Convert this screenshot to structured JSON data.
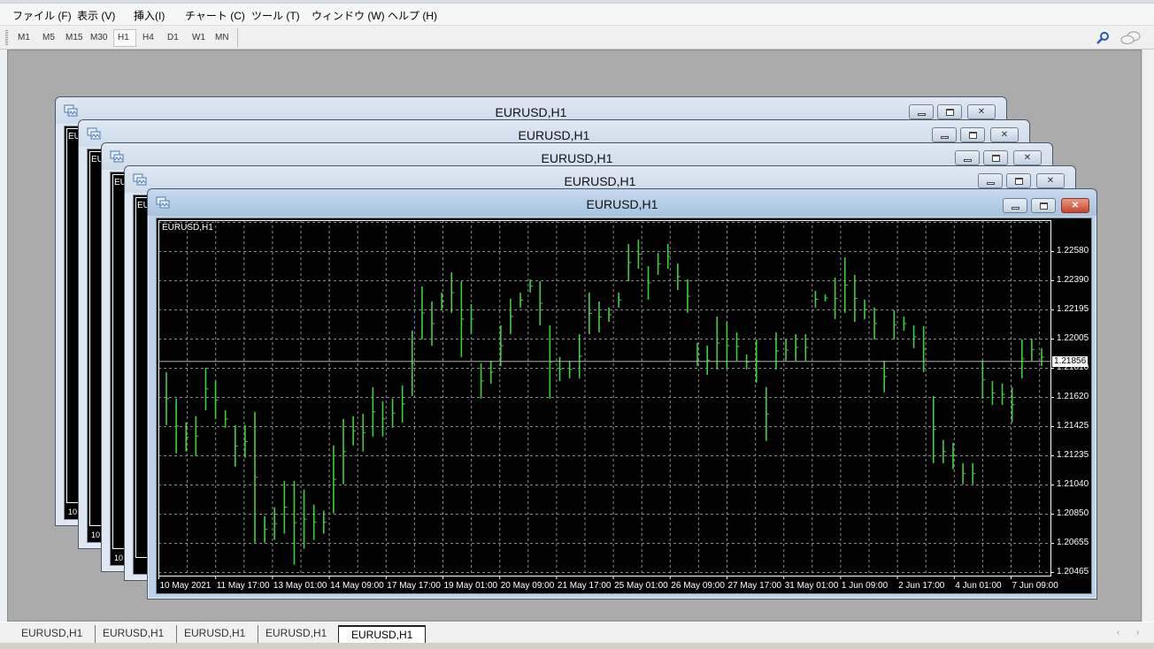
{
  "menu": {
    "items": [
      "ファイル (F)",
      "表示 (V)",
      "挿入(I)",
      "チャート (C)",
      "ツール (T)",
      "ウィンドウ (W)",
      "ヘルプ (H)"
    ]
  },
  "toolbar": {
    "timeframes": [
      "M1",
      "M5",
      "M15",
      "M30",
      "H1",
      "H4",
      "D1",
      "W1",
      "MN"
    ],
    "active_timeframe": "H1",
    "right_icons": [
      "search-icon",
      "chat-icon"
    ]
  },
  "windows": [
    {
      "title": "EURUSD,H1",
      "chart_label": "EU",
      "time_label": "10"
    },
    {
      "title": "EURUSD,H1",
      "chart_label": "EU",
      "time_label": "10"
    },
    {
      "title": "EURUSD,H1",
      "chart_label": "EU",
      "time_label": "10"
    },
    {
      "title": "EURUSD,H1",
      "chart_label": "EU",
      "time_label": "10"
    },
    {
      "title": "EURUSD,H1",
      "chart_label": "EURUSD,H1"
    }
  ],
  "window_buttons": {
    "minimize": "minimize",
    "maximize": "maximize",
    "close": "close"
  },
  "tabs": [
    {
      "label": "EURUSD,H1",
      "active": false
    },
    {
      "label": "EURUSD,H1",
      "active": false
    },
    {
      "label": "EURUSD,H1",
      "active": false
    },
    {
      "label": "EURUSD,H1",
      "active": false
    },
    {
      "label": "EURUSD,H1",
      "active": true
    }
  ],
  "tab_scroll": {
    "left": "‹",
    "right": "›"
  },
  "colors": {
    "bar": "#3fcf3f",
    "chart_bg": "#000000",
    "grid": "#8a8a8a",
    "mdi_bg": "#ababab"
  },
  "chart_data": {
    "type": "bar",
    "symbol": "EURUSD,H1",
    "y_ticks": [
      "1.22580",
      "1.22390",
      "1.22195",
      "1.22005",
      "1.21810",
      "1.21620",
      "1.21425",
      "1.21235",
      "1.21040",
      "1.20850",
      "1.20655",
      "1.20465"
    ],
    "x_ticks": [
      "10 May 2021",
      "11 May 17:00",
      "13 May 01:00",
      "14 May 09:00",
      "17 May 17:00",
      "19 May 01:00",
      "20 May 09:00",
      "21 May 17:00",
      "25 May 01:00",
      "26 May 09:00",
      "27 May 17:00",
      "31 May 01:00",
      "1 Jun 09:00",
      "2 Jun 17:00",
      "4 Jun 01:00",
      "7 Jun 09:00"
    ],
    "ylim": [
      1.2043,
      1.2276
    ],
    "grid": true,
    "current_price": "1.21856",
    "bars_high_low": [
      [
        1.21783,
        1.21433
      ],
      [
        1.21608,
        1.21247
      ],
      [
        1.21451,
        1.21259
      ],
      [
        1.21492,
        1.2123
      ],
      [
        1.21812,
        1.21532
      ],
      [
        1.21724,
        1.21474
      ],
      [
        1.21532,
        1.21416
      ],
      [
        1.21433,
        1.2116
      ],
      [
        1.21433,
        1.21218
      ],
      [
        1.21521,
        1.20659
      ],
      [
        1.20834,
        1.20659
      ],
      [
        1.20892,
        1.20677
      ],
      [
        1.21067,
        1.20718
      ],
      [
        1.21067,
        1.20514
      ],
      [
        1.21009,
        1.20619
      ],
      [
        1.2091,
        1.20677
      ],
      [
        1.20869,
        1.20718
      ],
      [
        1.213,
        1.20852
      ],
      [
        1.21474,
        1.21044
      ],
      [
        1.21492,
        1.213
      ],
      [
        1.21509,
        1.21259
      ],
      [
        1.21684,
        1.21358
      ],
      [
        1.21591,
        1.21358
      ],
      [
        1.21608,
        1.21416
      ],
      [
        1.21695,
        1.21451
      ],
      [
        1.22056,
        1.21626
      ],
      [
        1.22347,
        1.21998
      ],
      [
        1.22248,
        1.21957
      ],
      [
        1.22307,
        1.2219
      ],
      [
        1.2244,
        1.22173
      ],
      [
        1.22382,
        1.21882
      ],
      [
        1.22231,
        1.22033
      ],
      [
        1.21841,
        1.21608
      ],
      [
        1.21858,
        1.21707
      ],
      [
        1.22091,
        1.21823
      ],
      [
        1.22266,
        1.22033
      ],
      [
        1.22307,
        1.22208
      ],
      [
        1.22394,
        1.22307
      ],
      [
        1.22382,
        1.22091
      ],
      [
        1.22091,
        1.21608
      ],
      [
        1.21882,
        1.21724
      ],
      [
        1.21858,
        1.21742
      ],
      [
        1.22033,
        1.21742
      ],
      [
        1.22307,
        1.22033
      ],
      [
        1.22248,
        1.22045
      ],
      [
        1.22208,
        1.22114
      ],
      [
        1.22307,
        1.22208
      ],
      [
        1.22627,
        1.22382
      ],
      [
        1.22656,
        1.22464
      ],
      [
        1.22481,
        1.2226
      ],
      [
        1.22568,
        1.22423
      ],
      [
        1.22627,
        1.22464
      ],
      [
        1.22499,
        1.22324
      ],
      [
        1.22394,
        1.22173
      ],
      [
        1.21975,
        1.21823
      ],
      [
        1.21957,
        1.21765
      ],
      [
        1.22149,
        1.218
      ],
      [
        1.22114,
        1.218
      ],
      [
        1.22045,
        1.21858
      ],
      [
        1.21899,
        1.218
      ],
      [
        1.21998,
        1.21713
      ],
      [
        1.21684,
        1.21329
      ],
      [
        1.22045,
        1.218
      ],
      [
        1.21998,
        1.21858
      ],
      [
        1.22033,
        1.21858
      ],
      [
        1.22033,
        1.21858
      ],
      [
        1.22318,
        1.22208
      ],
      [
        1.22295,
        1.22248
      ],
      [
        1.22405,
        1.22132
      ],
      [
        1.22539,
        1.22173
      ],
      [
        1.22423,
        1.22114
      ],
      [
        1.2226,
        1.22132
      ],
      [
        1.22208,
        1.21998
      ],
      [
        1.21858,
        1.21649
      ],
      [
        1.2219,
        1.21998
      ],
      [
        1.22149,
        1.22056
      ],
      [
        1.22091,
        1.2194
      ],
      [
        1.22085,
        1.21783
      ],
      [
        1.21626,
        1.21183
      ],
      [
        1.21335,
        1.21183
      ],
      [
        1.21317,
        1.21143
      ],
      [
        1.21183,
        1.21044
      ],
      [
        1.21183,
        1.21044
      ],
      [
        1.21858,
        1.21608
      ],
      [
        1.21724,
        1.21567
      ],
      [
        1.21707,
        1.21567
      ],
      [
        1.21684,
        1.21451
      ],
      [
        1.21998,
        1.21742
      ],
      [
        1.22004,
        1.21858
      ],
      [
        1.2194,
        1.21823
      ]
    ]
  }
}
